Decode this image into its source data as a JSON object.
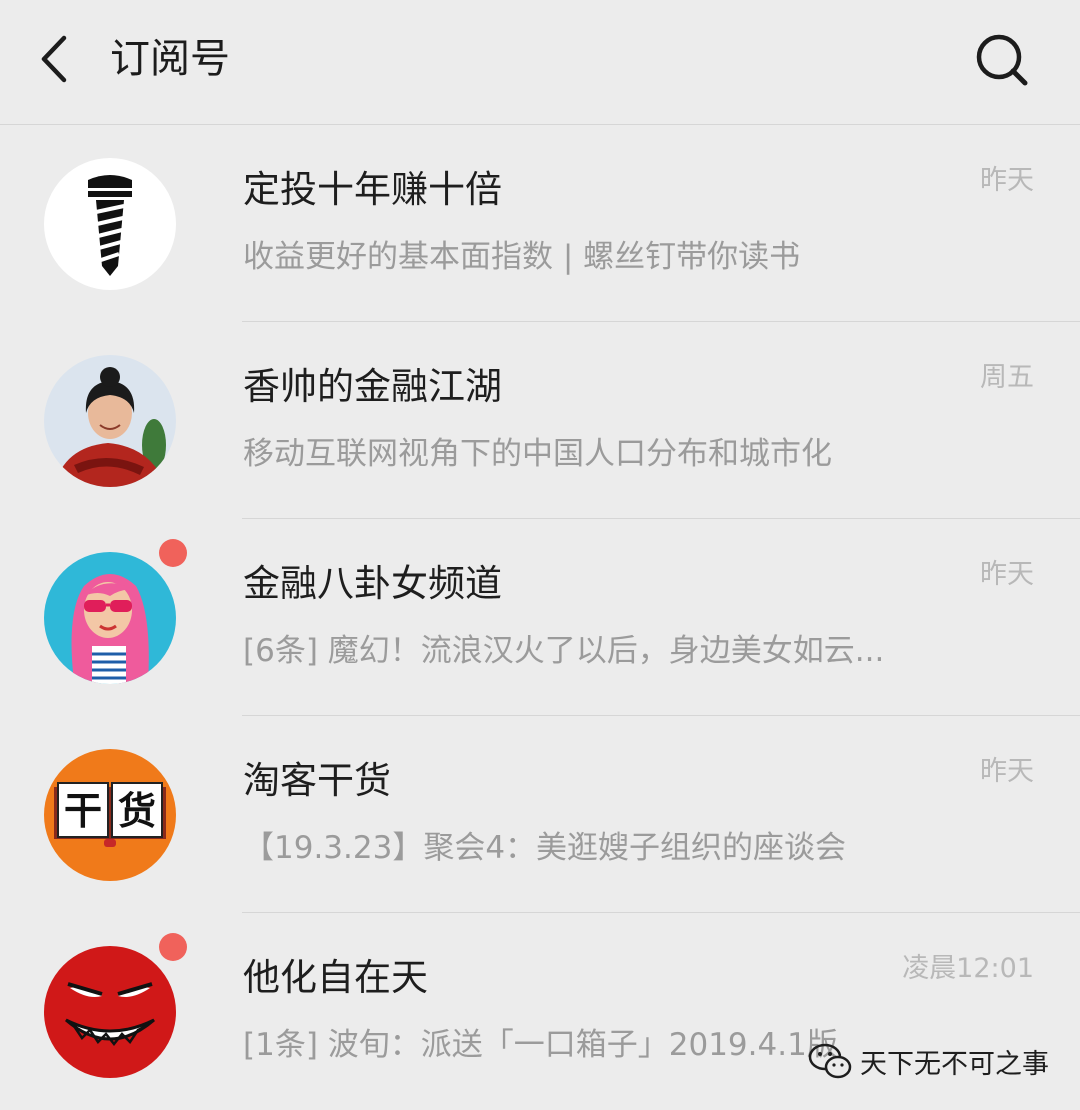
{
  "header": {
    "title": "订阅号",
    "back_icon": "chevron-left-icon",
    "search_icon": "search-icon"
  },
  "items": [
    {
      "name": "定投十年赚十倍",
      "preview": "收益更好的基本面指数 | 螺丝钉带你读书",
      "time": "昨天",
      "unread": false,
      "avatar": "screw-avatar"
    },
    {
      "name": "香帅的金融江湖",
      "preview": "移动互联网视角下的中国人口分布和城市化",
      "time": "周五",
      "unread": false,
      "avatar": "woman-photo-avatar"
    },
    {
      "name": "金融八卦女频道",
      "preview": "[6条] 魔幻！流浪汉火了以后，身边美女如云...",
      "time": "昨天",
      "unread": true,
      "avatar": "cartoon-girl-avatar"
    },
    {
      "name": "淘客干货",
      "preview": "【19.3.23】聚会4：美逛嫂子组织的座谈会",
      "time": "昨天",
      "unread": false,
      "avatar": "ganhuo-book-avatar",
      "avatar_text": "干货"
    },
    {
      "name": "他化自在天",
      "preview": "[1条] 波旬：派送「一口箱子」2019.4.1版",
      "time": "凌晨12:01",
      "unread": true,
      "avatar": "devil-face-avatar"
    }
  ],
  "watermark": {
    "text": "天下无不可之事",
    "icon": "wechat-icon"
  },
  "colors": {
    "background": "#ececec",
    "badge": "#f0625b",
    "divider": "#d6d6d6"
  }
}
